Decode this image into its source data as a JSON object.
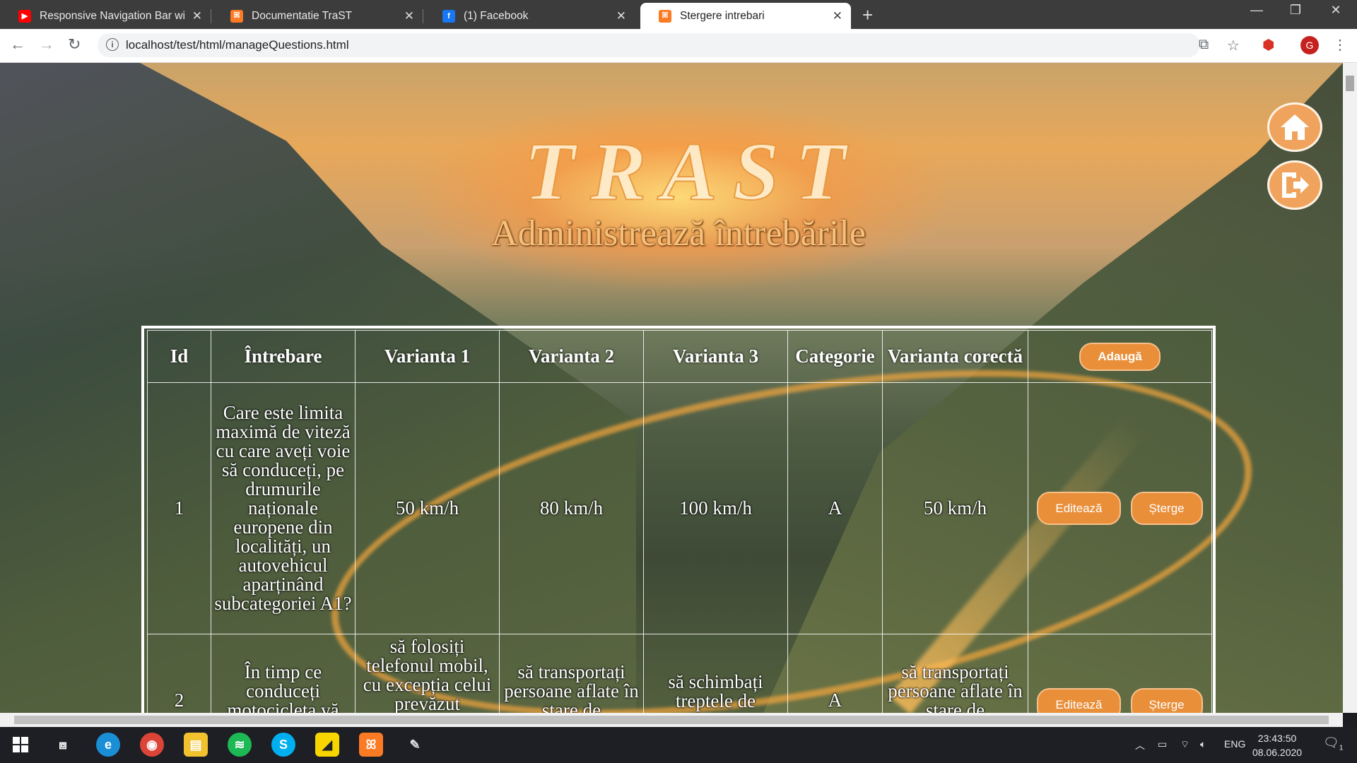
{
  "browser": {
    "tabs": [
      {
        "title": "Responsive Navigation Bar with I",
        "favicon": "youtube-icon",
        "color": "#ff0000"
      },
      {
        "title": "Documentatie TraST",
        "favicon": "xampp-icon",
        "color": "#fb7a24"
      },
      {
        "title": "(1) Facebook",
        "favicon": "facebook-icon",
        "color": "#1877f2"
      },
      {
        "title": "Stergere intrebari",
        "favicon": "xampp-icon",
        "color": "#fb7a24"
      }
    ],
    "url": "localhost/test/html/manageQuestions.html",
    "profile_initial": "G"
  },
  "page": {
    "logo": "TRAST",
    "heading": "Administrează întrebările",
    "side_buttons": [
      "home-icon",
      "logout-icon"
    ]
  },
  "table": {
    "headers": [
      "Id",
      "Întrebare",
      "Varianta 1",
      "Varianta 2",
      "Varianta 3",
      "Categorie",
      "Varianta corectă"
    ],
    "add_label": "Adaugă",
    "edit_label": "Editează",
    "delete_label": "Șterge",
    "rows": [
      {
        "id": "1",
        "question": "Care este limita maximă de viteză cu care aveți voie să conduceți, pe drumurile naționale europene din localități, un autovehicul aparținând subcategoriei A1?",
        "v1": "50 km/h",
        "v2": "80 km/h",
        "v3": "100 km/h",
        "category": "A",
        "correct": "50 km/h"
      },
      {
        "id": "2",
        "question": "În timp ce conduceți motocicleta vă",
        "v1": "să folosiți telefonul mobil, cu excepția celui prevăzut",
        "v2": "să transportați persoane aflate în stare de",
        "v3": "să schimbați treptele de",
        "category": "A",
        "correct": "să transportați persoane aflate în stare de"
      }
    ]
  },
  "taskbar": {
    "tray_language": "ENG",
    "time": "23:43:50",
    "date": "08.06.2020",
    "notifications": "1"
  }
}
